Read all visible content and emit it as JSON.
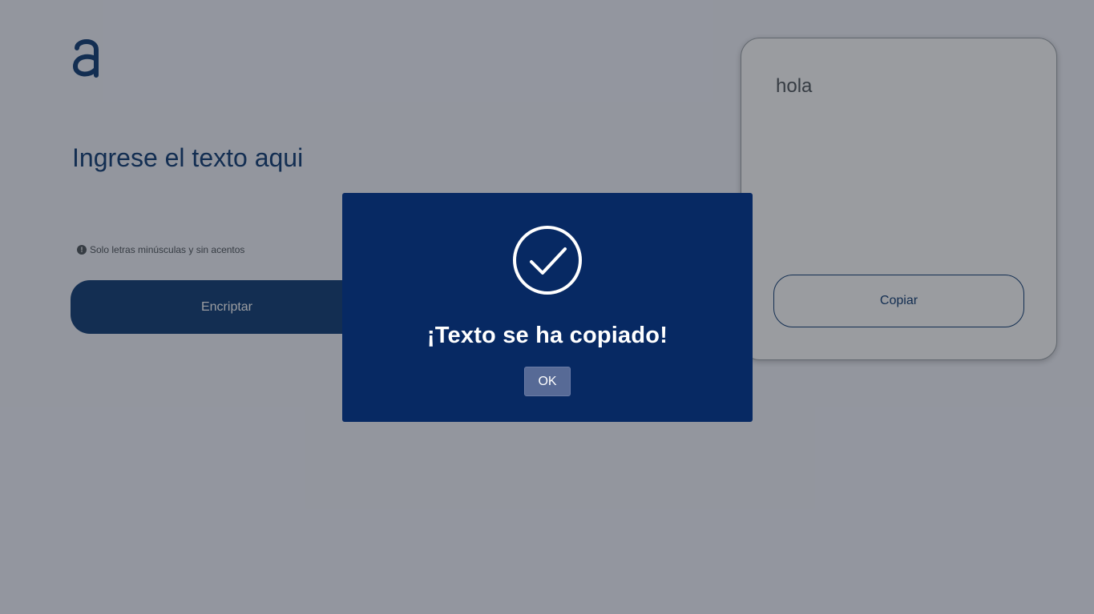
{
  "page": {
    "input_placeholder": "Ingrese el texto aqui",
    "hint": "Solo letras minúsculas y sin acentos",
    "hint_icon": "exclamation-circle-icon",
    "encrypt_label": "Encriptar",
    "decrypt_label": "",
    "output_text": "hola",
    "copy_label": "Copiar",
    "logo_icon": "alura-a-logo"
  },
  "modal": {
    "icon": "check-circle-icon",
    "title": "¡Texto se ha copiado!",
    "ok_label": "OK"
  },
  "colors": {
    "brand": "#0a3871",
    "modal_bg": "#072963",
    "ok_button": "#576a96"
  }
}
